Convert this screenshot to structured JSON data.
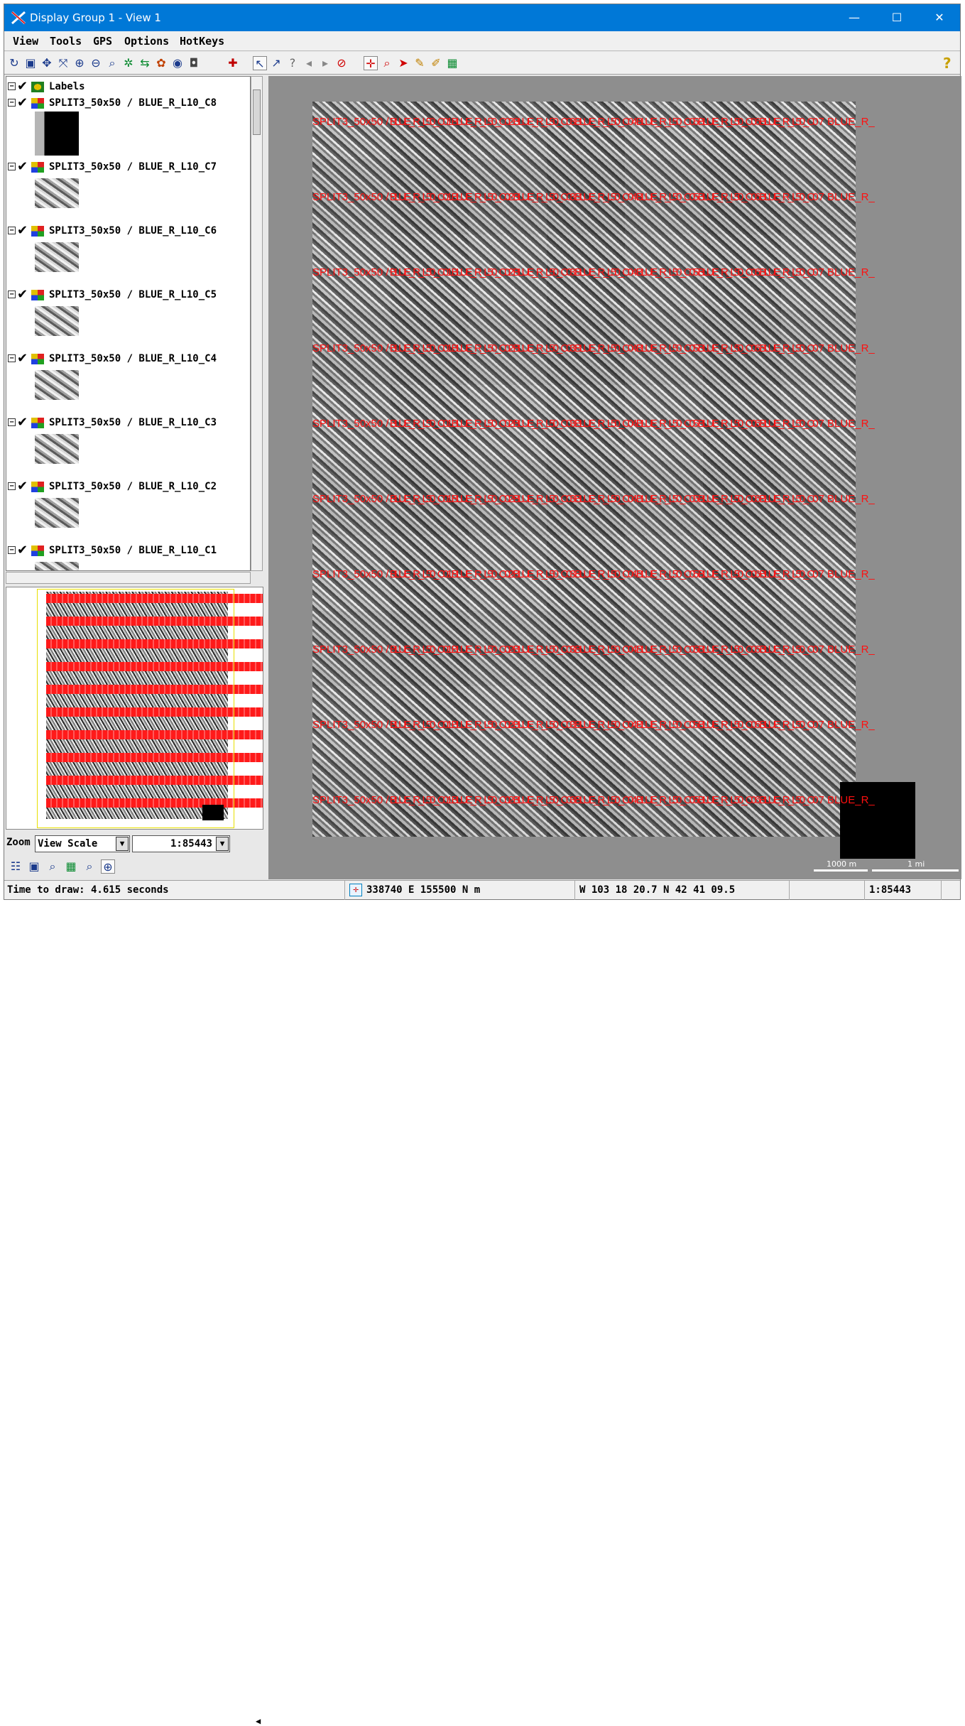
{
  "window": {
    "title": "Display Group 1 - View 1",
    "minimize": "—",
    "maximize": "☐",
    "close": "✕"
  },
  "menu": [
    "View",
    "Tools",
    "GPS",
    "Options",
    "HotKeys"
  ],
  "help_glyph": "?",
  "layers": [
    {
      "label": "Labels"
    },
    {
      "label": "SPLIT3_50x50 / BLUE_R_L10_C8"
    },
    {
      "label": "SPLIT3_50x50 / BLUE_R_L10_C7"
    },
    {
      "label": "SPLIT3_50x50 / BLUE_R_L10_C6"
    },
    {
      "label": "SPLIT3_50x50 / BLUE_R_L10_C5"
    },
    {
      "label": "SPLIT3_50x50 / BLUE_R_L10_C4"
    },
    {
      "label": "SPLIT3_50x50 / BLUE_R_L10_C3"
    },
    {
      "label": "SPLIT3_50x50 / BLUE_R_L10_C2"
    },
    {
      "label": "SPLIT3_50x50 / BLUE_R_L10_C1"
    }
  ],
  "zoom": {
    "label": "Zoom",
    "mode": "View Scale",
    "scale": "1:85443"
  },
  "map": {
    "row_label_start": "SPLIT3_50x50 /",
    "row_label_end": "07 BLUE_R_",
    "scalebar_metric": "1000 m",
    "scalebar_imperial": "1 mi"
  },
  "status": {
    "draw_time": "Time to draw: 4.615 seconds",
    "coords_projected": "338740 E   155500 N m",
    "coords_geographic": "W 103 18 20.7   N 42 41 09.5",
    "scale": "1:85443"
  }
}
